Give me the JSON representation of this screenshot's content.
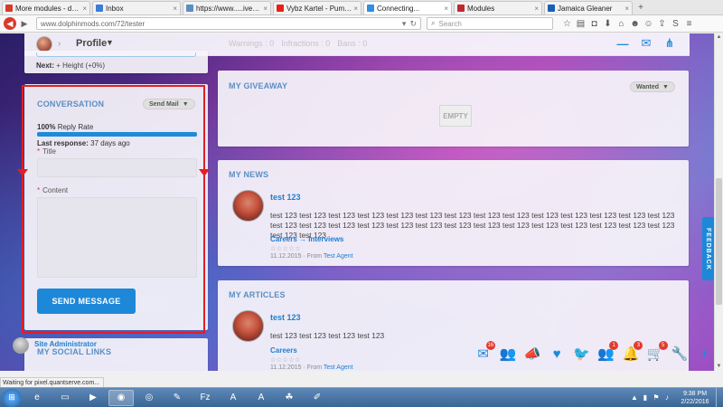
{
  "browser": {
    "tabs": [
      {
        "title": "More modules - dolphi",
        "favicon_color": "#d93a2a",
        "active": false
      },
      {
        "title": "Inbox",
        "favicon_color": "#3b7dd8",
        "active": false
      },
      {
        "title": "https://www.....ive_tracker",
        "favicon_color": "#5a8fc4",
        "active": false
      },
      {
        "title": "Vybz Kartel - Pum Pum",
        "favicon_color": "#e62117",
        "active": false
      },
      {
        "title": "Connecting...",
        "favicon_color": "#2f8fe0",
        "active": true
      },
      {
        "title": "Modules",
        "favicon_color": "#c1272d",
        "active": false
      },
      {
        "title": "Jamaica Gleaner",
        "favicon_color": "#1a5fb4",
        "active": false
      }
    ],
    "url": "www.dolphinmods.com/72/tester",
    "search_placeholder": "Search",
    "status_text": "Waiting for pixel.quantserve.com..."
  },
  "header": {
    "profile_label": "Profile",
    "stats": [
      "Warnings : 0",
      "Infractions : 0",
      "Bans : 0"
    ]
  },
  "stats_card": {
    "next_label": "Next:",
    "next_value": "+ Height (+0%)"
  },
  "conversation": {
    "title": "CONVERSATION",
    "send_mail_label": "Send Mail",
    "reply_rate_value": "100%",
    "reply_rate_label": "Reply Rate",
    "reply_rate_fraction": 1.0,
    "last_response_label": "Last response:",
    "last_response_value": "37 days ago",
    "title_field_label": "Title",
    "content_field_label": "Content",
    "send_button_label": "SEND MESSAGE"
  },
  "social": {
    "title": "MY SOCIAL LINKS"
  },
  "giveaway": {
    "title": "MY GIVEAWAY",
    "wanted_label": "Wanted",
    "empty_label": "EMPTY"
  },
  "news": {
    "title": "MY NEWS",
    "entry": {
      "title": "test 123",
      "body": "test 123 test 123 test 123 test 123 test 123 test 123 test 123 test 123 test 123 test 123 test 123 test 123 test 123 test 123 test 123 test 123 test 123 test 123 test 123 test 123 test 123 test 123 test 123 test 123 test 123 test 123 test 123 test 123 test 123 test 123",
      "category": "Careers → Interviews",
      "date": "11.12.2015",
      "from_label": "· From",
      "author": "Test Agent"
    }
  },
  "articles": {
    "title": "MY ARTICLES",
    "entry": {
      "title": "test 123",
      "body": "test 123 test 123 test 123 test 123",
      "category": "Careers",
      "date": "11.12.2015",
      "from_label": "· From",
      "author": "Test Agent"
    }
  },
  "feedback_label": "FEEDBACK",
  "bottom_user": {
    "name": "Site Administrator"
  },
  "notifications": [
    {
      "icon": "mail-icon",
      "glyph": "✉",
      "badge": "16"
    },
    {
      "icon": "friends-icon",
      "glyph": "👥",
      "badge": ""
    },
    {
      "icon": "megaphone-icon",
      "glyph": "📣",
      "badge": ""
    },
    {
      "icon": "heart-icon",
      "glyph": "♥",
      "badge": ""
    },
    {
      "icon": "twitter-icon",
      "glyph": "🐦",
      "badge": ""
    },
    {
      "icon": "group-icon",
      "glyph": "👥",
      "badge": "1"
    },
    {
      "icon": "bell-icon",
      "glyph": "🔔",
      "badge": "3"
    },
    {
      "icon": "cart-icon",
      "glyph": "🛒",
      "badge": "5"
    },
    {
      "icon": "wrench-icon",
      "glyph": "🔧",
      "badge": ""
    },
    {
      "icon": "plus-icon",
      "glyph": "+",
      "badge": ""
    }
  ],
  "taskbar": {
    "time": "9:38 PM",
    "date": "2/22/2016"
  },
  "colors": {
    "accent": "#1e88d8",
    "highlight_frame": "#e21e26",
    "card_title": "#5a8fc4"
  }
}
